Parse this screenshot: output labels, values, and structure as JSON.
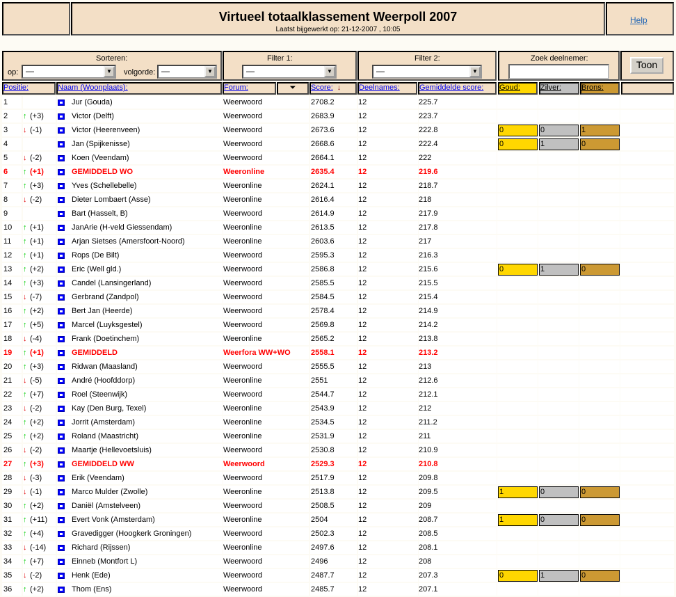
{
  "header": {
    "title": "Virtueel totaalklassement Weerpoll 2007",
    "updated": "Laatst bijgewerkt op: 21-12-2007 , 10:05",
    "help": "Help"
  },
  "controls": {
    "sort_label": "Sorteren:",
    "op_label": "op:",
    "order_label": "volgorde:",
    "sort_op_value": "—",
    "sort_order_value": "—",
    "filter1_label": "Filter 1:",
    "filter1_value": "—",
    "filter2_label": "Filter 2:",
    "filter2_value": "—",
    "search_label": "Zoek deelnemer:",
    "search_value": "",
    "show_button": "Toon"
  },
  "columns": {
    "position": "Positie:",
    "name": "Naam (Woonplaats):",
    "forum": "Forum:",
    "score": "Score:",
    "entries": "Deelnames:",
    "avg": "Gemiddelde score:",
    "gold": "Goud:",
    "silver": "Zilver:",
    "bronze": "Brons:"
  },
  "colors": {
    "gold": "#ffd700",
    "silver": "#c0c0c0",
    "bronze": "#cc9933",
    "header_bg": "#f3dfc6",
    "highlight": "#ff0000",
    "up": "#00cc00",
    "down": "#e00000"
  },
  "rows": [
    {
      "pos": "1",
      "dir": "",
      "change": "",
      "name": "Jur (Gouda)",
      "forum": "Weerwoord",
      "score": "2708.2",
      "entries": "12",
      "avg": "225.7"
    },
    {
      "pos": "2",
      "dir": "up",
      "change": "(+3)",
      "name": "Victor (Delft)",
      "forum": "Weerwoord",
      "score": "2683.9",
      "entries": "12",
      "avg": "223.7"
    },
    {
      "pos": "3",
      "dir": "down",
      "change": "(-1)",
      "name": "Victor (Heerenveen)",
      "forum": "Weerwoord",
      "score": "2673.6",
      "entries": "12",
      "avg": "222.8",
      "medals": [
        "0",
        "0",
        "1"
      ]
    },
    {
      "pos": "4",
      "dir": "",
      "change": "",
      "name": "Jan (Spijkenisse)",
      "forum": "Weerwoord",
      "score": "2668.6",
      "entries": "12",
      "avg": "222.4",
      "medals": [
        "0",
        "1",
        "0"
      ]
    },
    {
      "pos": "5",
      "dir": "down",
      "change": "(-2)",
      "name": "Koen (Veendam)",
      "forum": "Weerwoord",
      "score": "2664.1",
      "entries": "12",
      "avg": "222"
    },
    {
      "pos": "6",
      "dir": "up",
      "change": "(+1)",
      "name": "GEMIDDELD WO",
      "forum": "Weeronline",
      "score": "2635.4",
      "entries": "12",
      "avg": "219.6",
      "highlight": true
    },
    {
      "pos": "7",
      "dir": "up",
      "change": "(+3)",
      "name": "Yves (Schellebelle)",
      "forum": "Weeronline",
      "score": "2624.1",
      "entries": "12",
      "avg": "218.7"
    },
    {
      "pos": "8",
      "dir": "down",
      "change": "(-2)",
      "name": "Dieter Lombaert (Asse)",
      "forum": "Weeronline",
      "score": "2616.4",
      "entries": "12",
      "avg": "218"
    },
    {
      "pos": "9",
      "dir": "",
      "change": "",
      "name": "Bart (Hasselt, B)",
      "forum": "Weerwoord",
      "score": "2614.9",
      "entries": "12",
      "avg": "217.9"
    },
    {
      "pos": "10",
      "dir": "up",
      "change": "(+1)",
      "name": "JanArie (H-veld Giessendam)",
      "forum": "Weeronline",
      "score": "2613.5",
      "entries": "12",
      "avg": "217.8"
    },
    {
      "pos": "11",
      "dir": "up",
      "change": "(+1)",
      "name": "Arjan Sietses (Amersfoort-Noord)",
      "forum": "Weeronline",
      "score": "2603.6",
      "entries": "12",
      "avg": "217"
    },
    {
      "pos": "12",
      "dir": "up",
      "change": "(+1)",
      "name": "Rops (De Bilt)",
      "forum": "Weerwoord",
      "score": "2595.3",
      "entries": "12",
      "avg": "216.3"
    },
    {
      "pos": "13",
      "dir": "up",
      "change": "(+2)",
      "name": "Eric (Well gld.)",
      "forum": "Weerwoord",
      "score": "2586.8",
      "entries": "12",
      "avg": "215.6",
      "medals": [
        "0",
        "1",
        "0"
      ]
    },
    {
      "pos": "14",
      "dir": "up",
      "change": "(+3)",
      "name": "Candel (Lansingerland)",
      "forum": "Weerwoord",
      "score": "2585.5",
      "entries": "12",
      "avg": "215.5"
    },
    {
      "pos": "15",
      "dir": "down",
      "change": "(-7)",
      "name": "Gerbrand (Zandpol)",
      "forum": "Weerwoord",
      "score": "2584.5",
      "entries": "12",
      "avg": "215.4"
    },
    {
      "pos": "16",
      "dir": "up",
      "change": "(+2)",
      "name": "Bert Jan (Heerde)",
      "forum": "Weerwoord",
      "score": "2578.4",
      "entries": "12",
      "avg": "214.9"
    },
    {
      "pos": "17",
      "dir": "up",
      "change": "(+5)",
      "name": "Marcel (Luyksgestel)",
      "forum": "Weerwoord",
      "score": "2569.8",
      "entries": "12",
      "avg": "214.2"
    },
    {
      "pos": "18",
      "dir": "down",
      "change": "(-4)",
      "name": "Frank (Doetinchem)",
      "forum": "Weeronline",
      "score": "2565.2",
      "entries": "12",
      "avg": "213.8"
    },
    {
      "pos": "19",
      "dir": "up",
      "change": "(+1)",
      "name": "GEMIDDELD",
      "forum": "Weerfora WW+WO",
      "score": "2558.1",
      "entries": "12",
      "avg": "213.2",
      "highlight": true
    },
    {
      "pos": "20",
      "dir": "up",
      "change": "(+3)",
      "name": "Ridwan (Maasland)",
      "forum": "Weerwoord",
      "score": "2555.5",
      "entries": "12",
      "avg": "213"
    },
    {
      "pos": "21",
      "dir": "down",
      "change": "(-5)",
      "name": "André (Hoofddorp)",
      "forum": "Weeronline",
      "score": "2551",
      "entries": "12",
      "avg": "212.6"
    },
    {
      "pos": "22",
      "dir": "up",
      "change": "(+7)",
      "name": "Roel (Steenwijk)",
      "forum": "Weerwoord",
      "score": "2544.7",
      "entries": "12",
      "avg": "212.1"
    },
    {
      "pos": "23",
      "dir": "down",
      "change": "(-2)",
      "name": "Kay (Den Burg, Texel)",
      "forum": "Weeronline",
      "score": "2543.9",
      "entries": "12",
      "avg": "212"
    },
    {
      "pos": "24",
      "dir": "up",
      "change": "(+2)",
      "name": "Jorrit (Amsterdam)",
      "forum": "Weeronline",
      "score": "2534.5",
      "entries": "12",
      "avg": "211.2"
    },
    {
      "pos": "25",
      "dir": "up",
      "change": "(+2)",
      "name": "Roland (Maastricht)",
      "forum": "Weeronline",
      "score": "2531.9",
      "entries": "12",
      "avg": "211"
    },
    {
      "pos": "26",
      "dir": "down",
      "change": "(-2)",
      "name": "Maartje (Hellevoetsluis)",
      "forum": "Weerwoord",
      "score": "2530.8",
      "entries": "12",
      "avg": "210.9"
    },
    {
      "pos": "27",
      "dir": "up",
      "change": "(+3)",
      "name": "GEMIDDELD WW",
      "forum": "Weerwoord",
      "score": "2529.3",
      "entries": "12",
      "avg": "210.8",
      "highlight": true
    },
    {
      "pos": "28",
      "dir": "down",
      "change": "(-3)",
      "name": "Erik (Veendam)",
      "forum": "Weerwoord",
      "score": "2517.9",
      "entries": "12",
      "avg": "209.8"
    },
    {
      "pos": "29",
      "dir": "down",
      "change": "(-1)",
      "name": "Marco Mulder (Zwolle)",
      "forum": "Weeronline",
      "score": "2513.8",
      "entries": "12",
      "avg": "209.5",
      "medals": [
        "1",
        "0",
        "0"
      ]
    },
    {
      "pos": "30",
      "dir": "up",
      "change": "(+2)",
      "name": "Daniël (Amstelveen)",
      "forum": "Weerwoord",
      "score": "2508.5",
      "entries": "12",
      "avg": "209"
    },
    {
      "pos": "31",
      "dir": "up",
      "change": "(+11)",
      "name": "Evert Vonk (Amsterdam)",
      "forum": "Weeronline",
      "score": "2504",
      "entries": "12",
      "avg": "208.7",
      "medals": [
        "1",
        "0",
        "0"
      ]
    },
    {
      "pos": "32",
      "dir": "up",
      "change": "(+4)",
      "name": "Gravedigger (Hoogkerk Groningen)",
      "forum": "Weerwoord",
      "score": "2502.3",
      "entries": "12",
      "avg": "208.5"
    },
    {
      "pos": "33",
      "dir": "down",
      "change": "(-14)",
      "name": "Richard (Rijssen)",
      "forum": "Weeronline",
      "score": "2497.6",
      "entries": "12",
      "avg": "208.1"
    },
    {
      "pos": "34",
      "dir": "up",
      "change": "(+7)",
      "name": "Einneb (Montfort L)",
      "forum": "Weerwoord",
      "score": "2496",
      "entries": "12",
      "avg": "208"
    },
    {
      "pos": "35",
      "dir": "down",
      "change": "(-2)",
      "name": "Henk (Ede)",
      "forum": "Weerwoord",
      "score": "2487.7",
      "entries": "12",
      "avg": "207.3",
      "medals": [
        "0",
        "1",
        "0"
      ]
    },
    {
      "pos": "36",
      "dir": "up",
      "change": "(+2)",
      "name": "Thom (Ens)",
      "forum": "Weerwoord",
      "score": "2485.7",
      "entries": "12",
      "avg": "207.1"
    }
  ]
}
